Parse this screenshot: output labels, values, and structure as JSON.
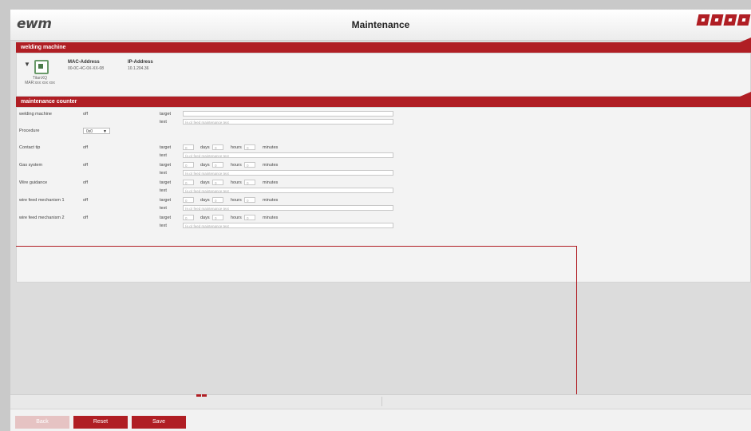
{
  "header": {
    "logo": "ewm",
    "title": "Maintenance",
    "icons": [
      "home-icon",
      "back-icon",
      "info-icon",
      "close-icon"
    ]
  },
  "machine_section": {
    "title": "welding machine",
    "machine_name": "TitanXQ",
    "machine_sub": "MAR:xxx xxx xxx",
    "mac_label": "MAC-Address",
    "mac_value": "00-0C-4C-0X-XX-08",
    "ip_label": "IP-Address",
    "ip_value": "10.1.204.36"
  },
  "maintenance_section": {
    "title": "maintenance counter",
    "target_label": "target",
    "text_label": "text",
    "days_label": "days",
    "hours_label": "hours",
    "minutes_label": "minutes",
    "placeholder": "(e.g) feed maintenance text",
    "rows": [
      {
        "name": "welding machine",
        "state": "off",
        "counter": false
      },
      {
        "name": "Contact tip",
        "state": "off",
        "counter": true,
        "d": "0",
        "h": "0",
        "m": "0"
      },
      {
        "name": "Gas system",
        "state": "off",
        "counter": true,
        "d": "0",
        "h": "0",
        "m": "0"
      },
      {
        "name": "Wire guidance",
        "state": "off",
        "counter": true,
        "d": "0",
        "h": "0",
        "m": "0"
      },
      {
        "name": "wire feed mechanism 1",
        "state": "off",
        "counter": true,
        "d": "0",
        "h": "0",
        "m": "0"
      },
      {
        "name": "wire feed mechanism 2",
        "state": "off",
        "counter": true,
        "d": "0",
        "h": "0",
        "m": "0"
      }
    ],
    "procedure_label": "Procedure",
    "procedure_value": "0x0"
  },
  "footer": {
    "back_label": "Back",
    "reset_label": "Reset",
    "save_label": "Save"
  },
  "colors": {
    "accent": "#b01e24",
    "background": "#dcdcdc"
  }
}
